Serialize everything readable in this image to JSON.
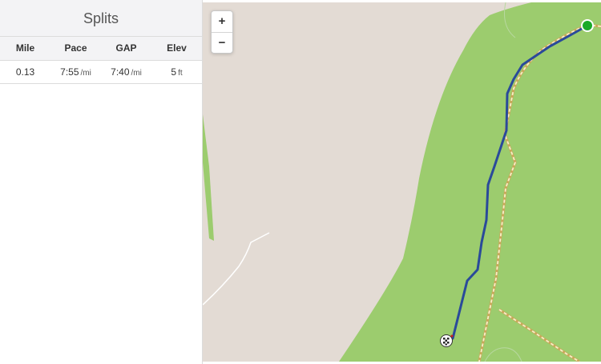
{
  "splits": {
    "title": "Splits",
    "columns": [
      "Mile",
      "Pace",
      "GAP",
      "Elev"
    ],
    "rows": [
      {
        "mile": "0.13",
        "pace": "7:55",
        "pace_unit": "/mi",
        "gap": "7:40",
        "gap_unit": "/mi",
        "elev": "5",
        "elev_unit": "ft"
      }
    ]
  },
  "map": {
    "zoom_in_label": "+",
    "zoom_out_label": "−",
    "colors": {
      "land": "#e3dbd4",
      "park": "#9ccc6e",
      "route": "#2a4a9a",
      "start_marker": "#1aaa2a",
      "trail": "#f6f0c8"
    },
    "icons": [
      "start-marker-icon",
      "finish-flag-icon"
    ]
  }
}
